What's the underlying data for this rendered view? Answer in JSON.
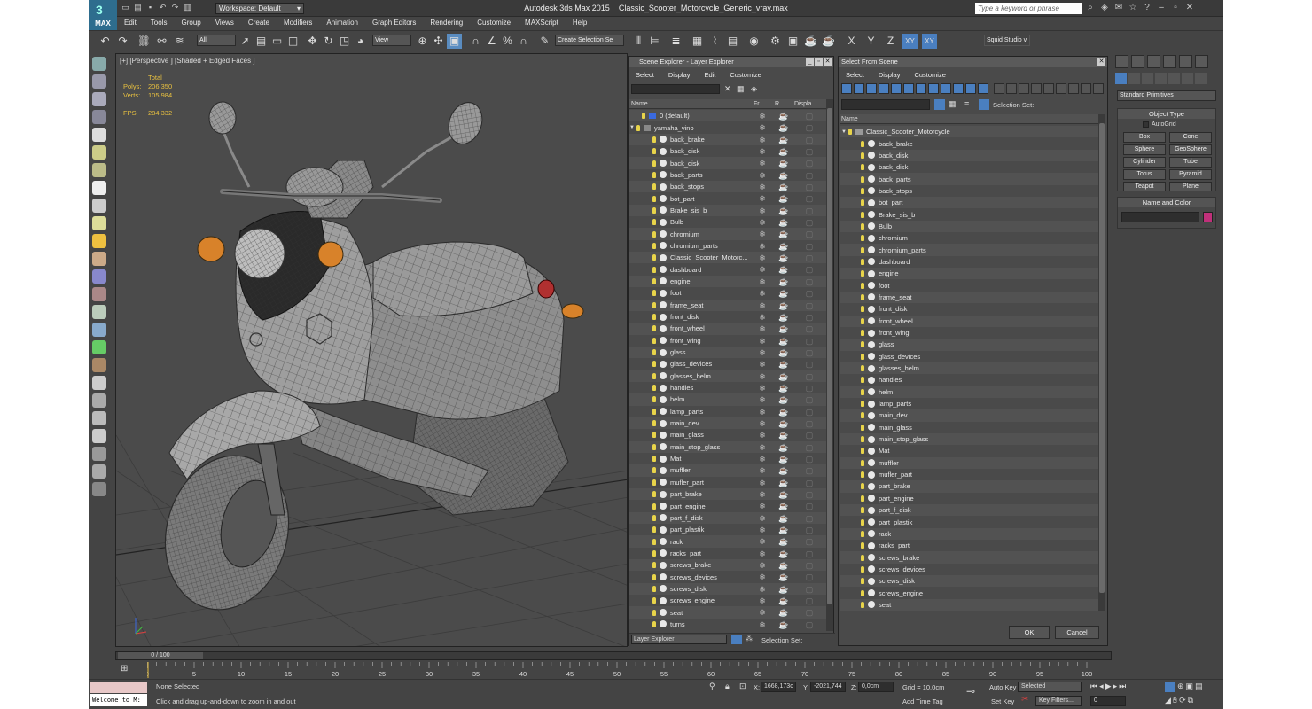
{
  "title": {
    "app": "Autodesk 3ds Max  2015",
    "file": "Classic_Scooter_Motorcycle_Generic_vray.max",
    "logo": "MAX",
    "workspace": "Workspace: Default",
    "search_placeholder": "Type a keyword or phrase"
  },
  "menu": [
    "Edit",
    "Tools",
    "Group",
    "Views",
    "Create",
    "Modifiers",
    "Animation",
    "Graph Editors",
    "Rendering",
    "Customize",
    "MAXScript",
    "Help"
  ],
  "toolbar": {
    "filter": "All",
    "coord": "View",
    "selection_set": "Create Selection Se",
    "axes": [
      "X",
      "Y",
      "Z",
      "XY",
      "XY"
    ],
    "studio": "Squid Studio v"
  },
  "viewport": {
    "label": "[+] [Perspective ] [Shaded + Edged Faces ]",
    "stats_header": "Total",
    "stats": [
      {
        "k": "Polys:",
        "v": "206 350"
      },
      {
        "k": "Verts:",
        "v": "105 984"
      }
    ],
    "fps_label": "FPS:",
    "fps": "284,332"
  },
  "layer_explorer": {
    "title": "Scene Explorer - Layer Explorer",
    "menu": [
      "Select",
      "Display",
      "Edit",
      "Customize"
    ],
    "columns": [
      "Name",
      "Fr...",
      "R...",
      "Displa..."
    ],
    "layers": [
      {
        "name": "0 (default)",
        "level": 0
      },
      {
        "name": "yamaha_vino",
        "level": 0
      }
    ],
    "items": [
      "back_brake",
      "back_disk",
      "back_disk",
      "back_parts",
      "back_stops",
      "bot_part",
      "Brake_sis_b",
      "Bulb",
      "chromium",
      "chromium_parts",
      "Classic_Scooter_Motorc...",
      "dashboard",
      "engine",
      "foot",
      "frame_seat",
      "front_disk",
      "front_wheel",
      "front_wing",
      "glass",
      "glass_devices",
      "glasses_helm",
      "handles",
      "helm",
      "lamp_parts",
      "main_dev",
      "main_glass",
      "main_stop_glass",
      "Mat",
      "muffler",
      "mufler_part",
      "part_brake",
      "part_engine",
      "part_f_disk",
      "part_plastik",
      "rack",
      "racks_part",
      "screws_brake",
      "screws_devices",
      "screws_disk",
      "screws_engine",
      "seat",
      "turns"
    ],
    "footer_dropdown": "Layer Explorer",
    "footer_selset": "Selection Set:"
  },
  "select_from_scene": {
    "title": "Select From Scene",
    "menu": [
      "Select",
      "Display",
      "Customize"
    ],
    "selection_set": "Selection Set:",
    "column": "Name",
    "root": "Classic_Scooter_Motorcycle",
    "items": [
      "back_brake",
      "back_disk",
      "back_disk",
      "back_parts",
      "back_stops",
      "bot_part",
      "Brake_sis_b",
      "Bulb",
      "chromium",
      "chromium_parts",
      "dashboard",
      "engine",
      "foot",
      "frame_seat",
      "front_disk",
      "front_wheel",
      "front_wing",
      "glass",
      "glass_devices",
      "glasses_helm",
      "handles",
      "helm",
      "lamp_parts",
      "main_dev",
      "main_glass",
      "main_stop_glass",
      "Mat",
      "muffler",
      "mufler_part",
      "part_brake",
      "part_engine",
      "part_f_disk",
      "part_plastik",
      "rack",
      "racks_part",
      "screws_brake",
      "screws_devices",
      "screws_disk",
      "screws_engine",
      "seat"
    ],
    "ok": "OK",
    "cancel": "Cancel"
  },
  "command_panel": {
    "category": "Standard Primitives",
    "object_type": "Object Type",
    "autogrid": "AutoGrid",
    "buttons": [
      "Box",
      "Cone",
      "Sphere",
      "GeoSphere",
      "Cylinder",
      "Tube",
      "Torus",
      "Pyramid",
      "Teapot",
      "Plane"
    ],
    "name_color": "Name and Color",
    "swatch_color": "#c0307a"
  },
  "timeline": {
    "frame": "0 / 100",
    "ticks": [
      "0",
      "5",
      "10",
      "15",
      "20",
      "25",
      "30",
      "35",
      "40",
      "45",
      "50",
      "55",
      "60",
      "65",
      "70",
      "75",
      "80",
      "85",
      "90",
      "95",
      "100"
    ]
  },
  "status": {
    "maxscript": "Welcome to M:",
    "selection": "None Selected",
    "prompt": "Click and drag up-and-down to zoom in and out",
    "x_label": "X:",
    "x": "1668,173c",
    "y_label": "Y:",
    "y": "-2021,744",
    "z_label": "Z:",
    "z": "0,0cm",
    "grid": "Grid = 10,0cm",
    "add_time_tag": "Add Time Tag",
    "auto_key": "Auto Key",
    "set_key": "Set Key",
    "selected": "Selected",
    "key_filters": "Key Filters...",
    "frame_field": "0"
  }
}
